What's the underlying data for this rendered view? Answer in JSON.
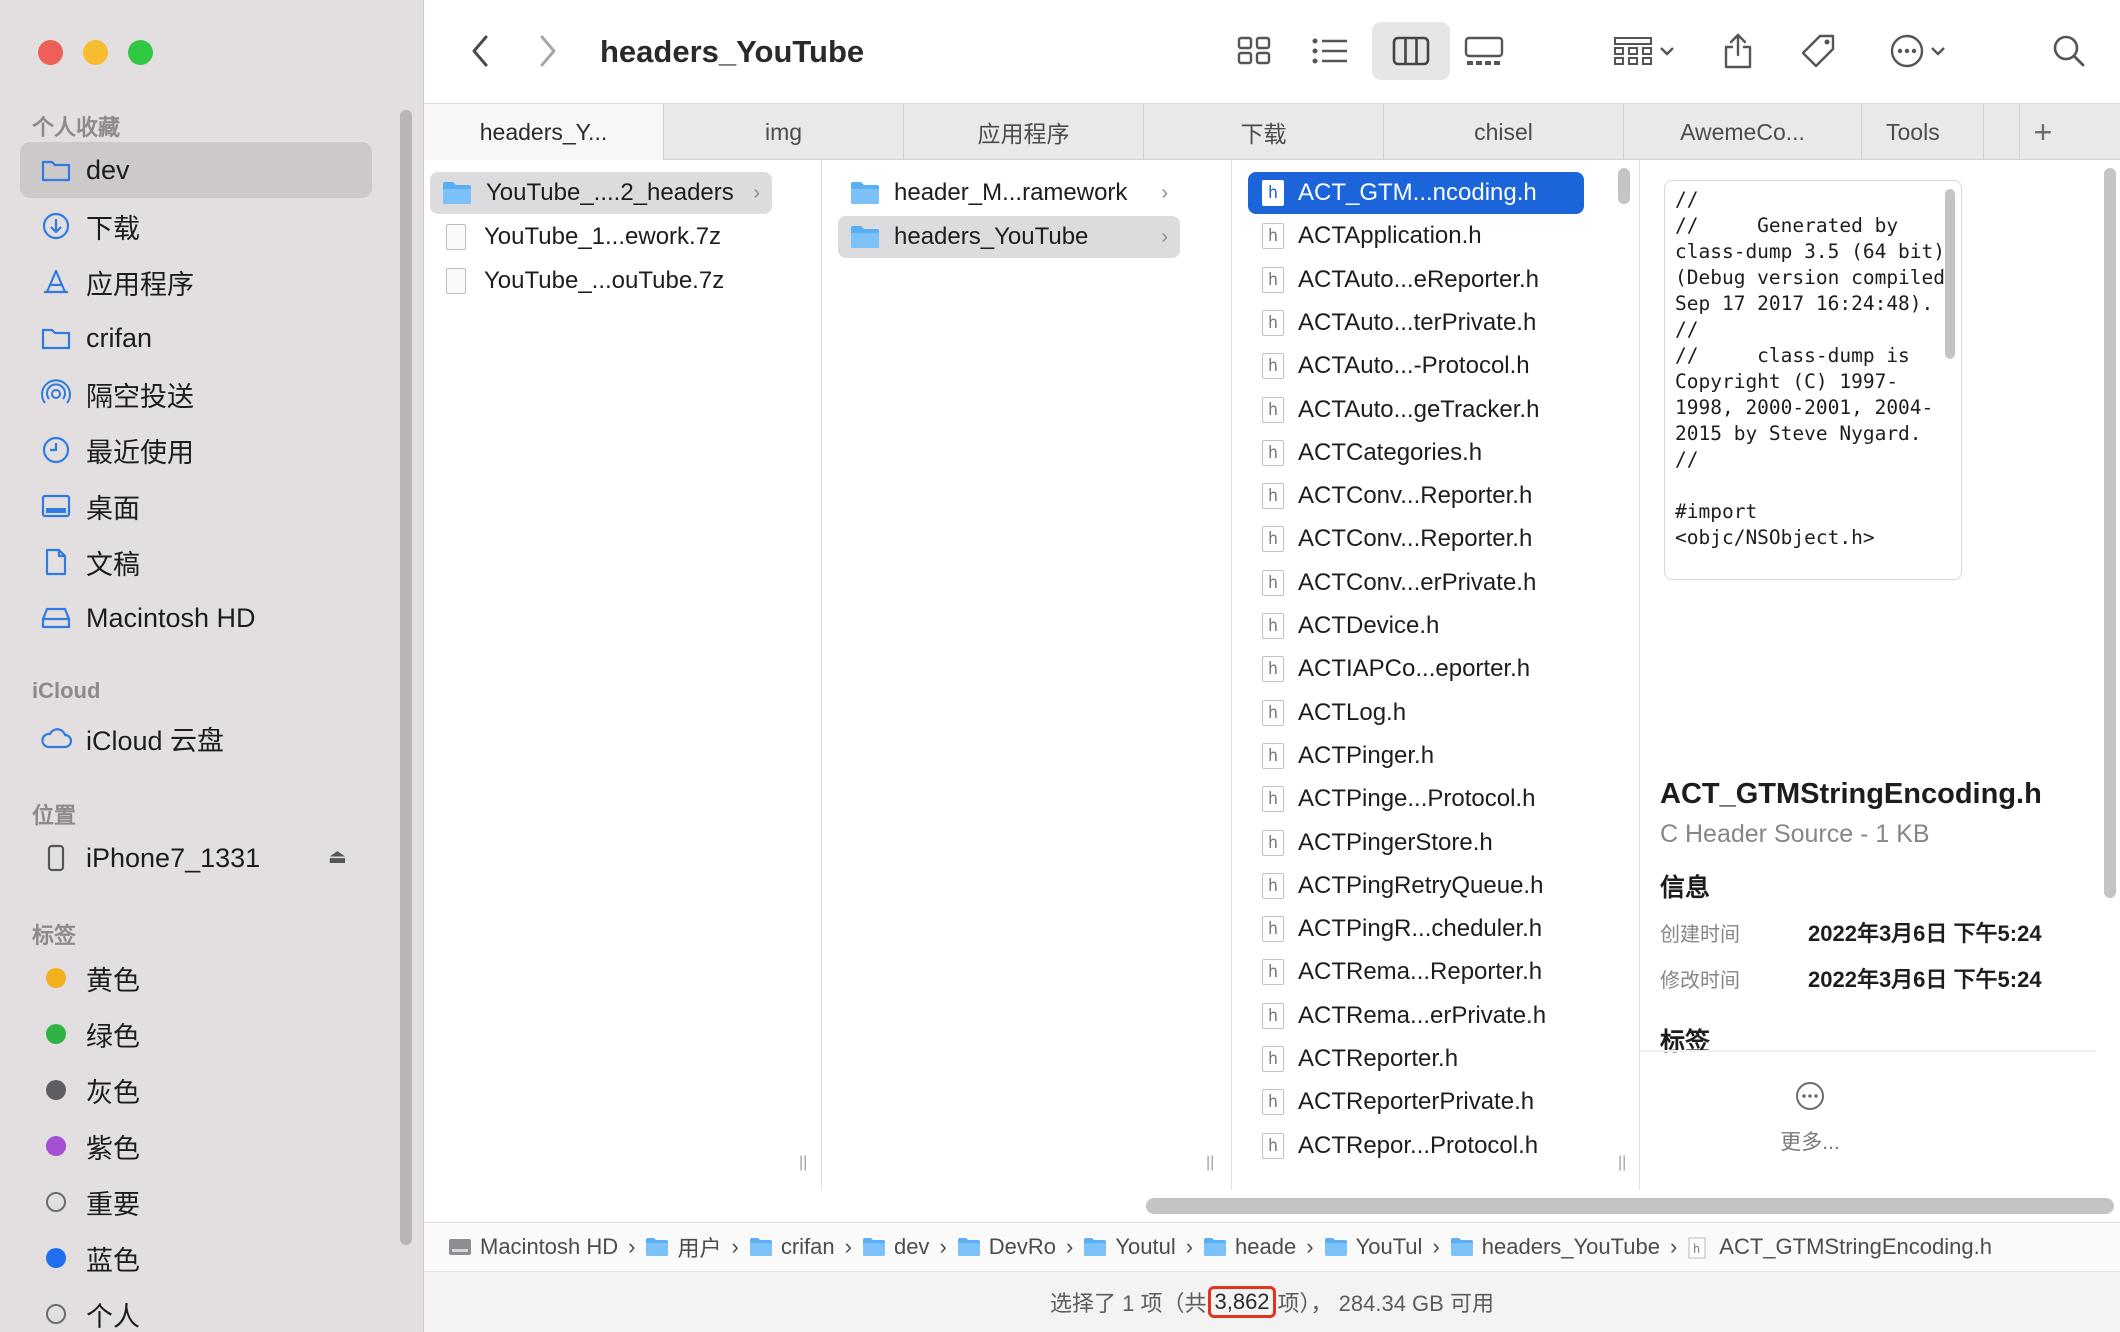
{
  "window": {
    "title": "headers_YouTube"
  },
  "sidebar": {
    "favorites_title": "个人收藏",
    "favorites": [
      {
        "label": "dev",
        "icon": "folder-icon",
        "selected": true
      },
      {
        "label": "下载",
        "icon": "download-icon"
      },
      {
        "label": "应用程序",
        "icon": "applications-icon"
      },
      {
        "label": "crifan",
        "icon": "folder-icon"
      },
      {
        "label": "隔空投送",
        "icon": "airdrop-icon"
      },
      {
        "label": "最近使用",
        "icon": "clock-icon"
      },
      {
        "label": "桌面",
        "icon": "desktop-icon"
      },
      {
        "label": "文稿",
        "icon": "document-icon"
      },
      {
        "label": "Macintosh HD",
        "icon": "disk-icon"
      }
    ],
    "icloud_title": "iCloud",
    "icloud": [
      {
        "label": "iCloud 云盘",
        "icon": "cloud-icon"
      }
    ],
    "locations_title": "位置",
    "locations": [
      {
        "label": "iPhone7_1331",
        "icon": "phone-icon"
      }
    ],
    "tags_title": "标签",
    "tags": [
      {
        "label": "黄色",
        "color": "#f2b01e"
      },
      {
        "label": "绿色",
        "color": "#2fb344"
      },
      {
        "label": "灰色",
        "color": "#5f5f63"
      },
      {
        "label": "紫色",
        "color": "#a550d2"
      },
      {
        "label": "重要",
        "color": "none"
      },
      {
        "label": "蓝色",
        "color": "#1f6ff0"
      },
      {
        "label": "个人",
        "color": "none"
      }
    ]
  },
  "tabs": [
    {
      "label": "headers_Y...",
      "active": true
    },
    {
      "label": "img"
    },
    {
      "label": "应用程序"
    },
    {
      "label": "下载"
    },
    {
      "label": "chisel"
    },
    {
      "label": "AwemeCo..."
    },
    {
      "label": "Tools"
    }
  ],
  "tab_add": "+",
  "columns": {
    "col1": [
      {
        "label": "YouTube_....2_headers",
        "type": "folder",
        "selected": "gray"
      },
      {
        "label": "YouTube_1...ework.7z",
        "type": "7z"
      },
      {
        "label": "YouTube_...ouTube.7z",
        "type": "7z"
      }
    ],
    "col2": [
      {
        "label": "header_M...ramework",
        "type": "folder"
      },
      {
        "label": "headers_YouTube",
        "type": "folder",
        "selected": "gray"
      }
    ],
    "col3": [
      {
        "label": "ACT_GTM...ncoding.h",
        "selected": "blue"
      },
      {
        "label": "ACTApplication.h"
      },
      {
        "label": "ACTAuto...eReporter.h"
      },
      {
        "label": "ACTAuto...terPrivate.h"
      },
      {
        "label": "ACTAuto...-Protocol.h"
      },
      {
        "label": "ACTAuto...geTracker.h"
      },
      {
        "label": "ACTCategories.h"
      },
      {
        "label": "ACTConv...Reporter.h"
      },
      {
        "label": "ACTConv...Reporter.h"
      },
      {
        "label": "ACTConv...erPrivate.h"
      },
      {
        "label": "ACTDevice.h"
      },
      {
        "label": "ACTIAPCo...eporter.h"
      },
      {
        "label": "ACTLog.h"
      },
      {
        "label": "ACTPinger.h"
      },
      {
        "label": "ACTPinge...Protocol.h"
      },
      {
        "label": "ACTPingerStore.h"
      },
      {
        "label": "ACTPingRetryQueue.h"
      },
      {
        "label": "ACTPingR...cheduler.h"
      },
      {
        "label": "ACTRema...Reporter.h"
      },
      {
        "label": "ACTRema...erPrivate.h"
      },
      {
        "label": "ACTReporter.h"
      },
      {
        "label": "ACTReporterPrivate.h"
      },
      {
        "label": "ACTRepor...Protocol.h"
      }
    ],
    "file_badge": "h"
  },
  "preview": {
    "code": "//\n//     Generated by class-dump 3.5 (64 bit) (Debug version compiled Sep 17 2017 16:24:48).\n//\n//     class-dump is Copyright (C) 1997-1998, 2000-2001, 2004-2015 by Steve Nygard.\n//\n\n#import <objc/NSObject.h>\n\n@class NSData;\n\n@interface ACT_GTMStringEncoding : NSObject\n{\n    NSData *charMapData_;",
    "filename": "ACT_GTMStringEncoding.h",
    "kind": "C Header Source - 1 KB",
    "info_title": "信息",
    "created_label": "创建时间",
    "created_value": "2022年3月6日 下午5:24",
    "modified_label": "修改时间",
    "modified_value": "2022年3月6日 下午5:24",
    "tags_title": "标签",
    "more_label": "更多..."
  },
  "pathbar": [
    {
      "label": "Macintosh HD",
      "icon": "disk-icon"
    },
    {
      "label": "用户",
      "icon": "folder-icon"
    },
    {
      "label": "crifan",
      "icon": "folder-icon"
    },
    {
      "label": "dev",
      "icon": "folder-icon"
    },
    {
      "label": "DevRo",
      "icon": "folder-icon"
    },
    {
      "label": "Youtul",
      "icon": "folder-icon"
    },
    {
      "label": "heade",
      "icon": "folder-icon"
    },
    {
      "label": "YouTul",
      "icon": "folder-icon"
    },
    {
      "label": "headers_YouTube",
      "icon": "folder-icon"
    },
    {
      "label": "ACT_GTMStringEncoding.h",
      "icon": "header-file-icon"
    }
  ],
  "status": {
    "prefix": "选择了 1 项（共",
    "count": "3,862",
    "suffix": "项），  284.34 GB 可用"
  }
}
